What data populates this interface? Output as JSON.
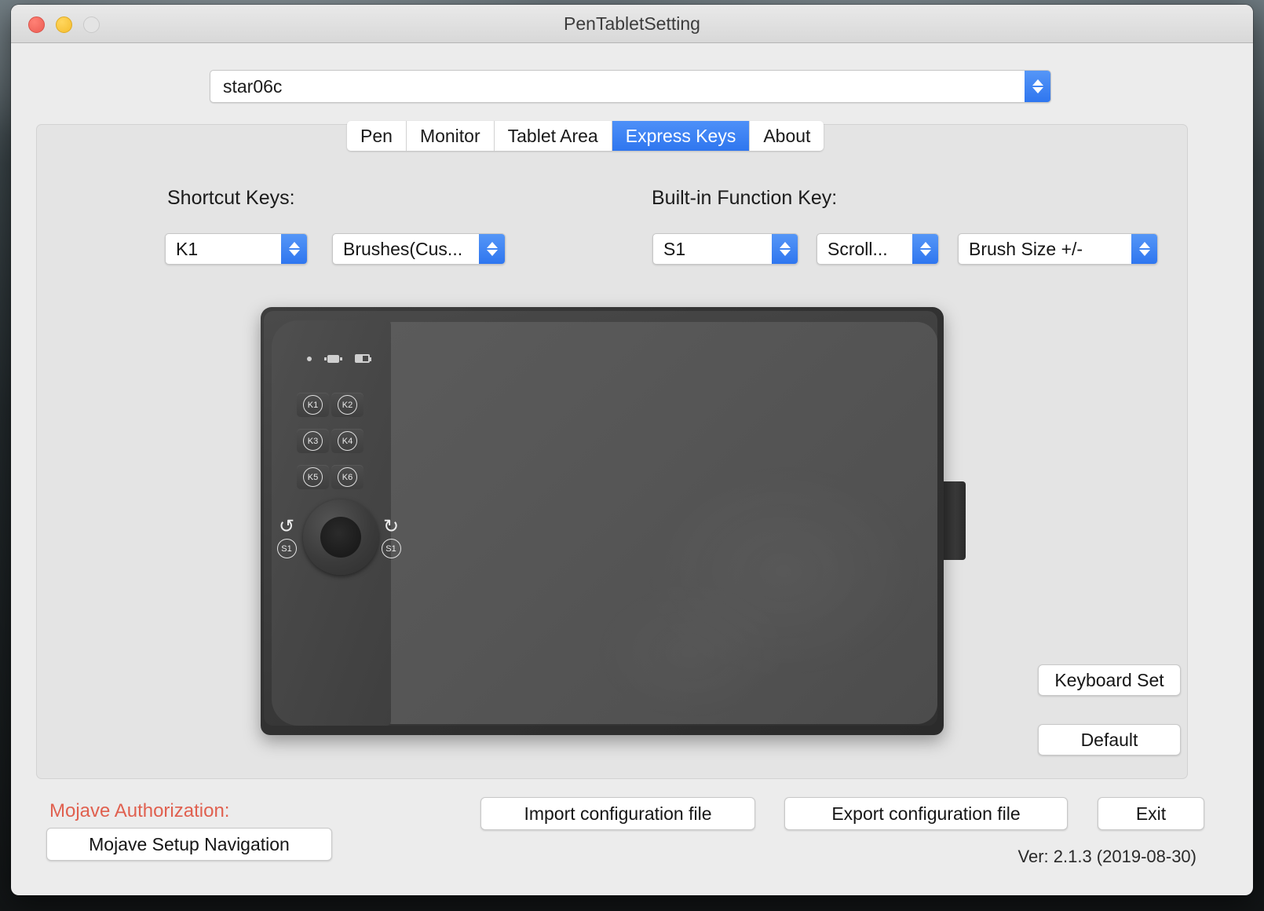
{
  "window": {
    "title": "PenTabletSetting",
    "traffic_lights": [
      "close",
      "minimize",
      "zoom"
    ]
  },
  "device_select": {
    "value": "star06c"
  },
  "tabs": [
    {
      "label": "Pen",
      "active": false
    },
    {
      "label": "Monitor",
      "active": false
    },
    {
      "label": "Tablet Area",
      "active": false
    },
    {
      "label": "Express Keys",
      "active": true
    },
    {
      "label": "About",
      "active": false
    }
  ],
  "shortcut_section": {
    "label": "Shortcut Keys:",
    "key_select": "K1",
    "function_select": "Brushes(Cus..."
  },
  "builtin_section": {
    "label": "Built-in Function Key:",
    "key_select": "S1",
    "mode_select": "Scroll...",
    "function_select": "Brush Size +/-"
  },
  "tablet": {
    "keys": [
      "K1",
      "K2",
      "K3",
      "K4",
      "K5",
      "K6"
    ],
    "dial_left_label": "S1",
    "dial_right_label": "S1",
    "dial_left_arrow": "↺",
    "dial_right_arrow": "↻"
  },
  "side_buttons": {
    "keyboard_set": "Keyboard Set",
    "default": "Default"
  },
  "footer": {
    "auth_label": "Mojave Authorization:",
    "mojave_setup": "Mojave Setup Navigation",
    "import": "Import configuration file",
    "export": "Export configuration file",
    "exit": "Exit",
    "version": "Ver: 2.1.3 (2019-08-30)"
  },
  "colors": {
    "accent": "#2f76ef",
    "warning": "#e0604f",
    "window_bg": "#ececec",
    "panel_bg": "#e4e4e4"
  }
}
